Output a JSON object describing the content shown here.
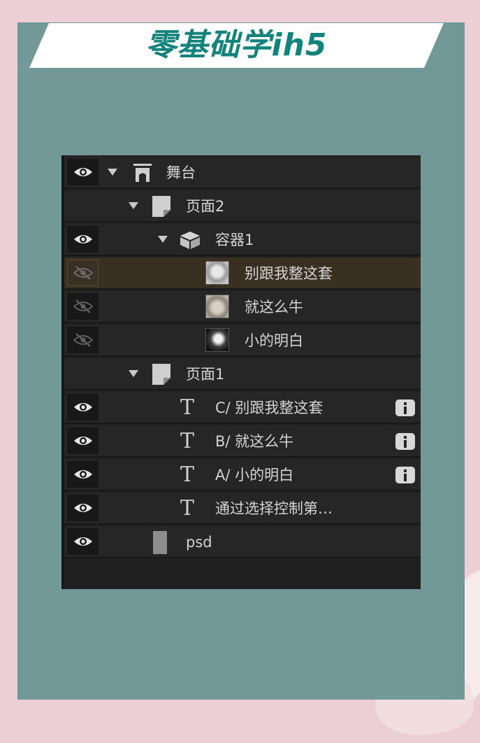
{
  "banner": {
    "title": "零基础学ih5"
  },
  "layers": {
    "stage": {
      "label": "舞台",
      "visible": true,
      "icon": "stage-icon"
    },
    "page2": {
      "label": "页面2",
      "icon": "page-icon"
    },
    "container1": {
      "label": "容器1",
      "visible": true,
      "icon": "box-icon"
    },
    "img_a": {
      "label": "别跟我整这套",
      "visible": false,
      "selected": true,
      "icon": "image-thumbnail"
    },
    "img_b": {
      "label": "就这么牛",
      "visible": false,
      "icon": "image-thumbnail"
    },
    "img_c": {
      "label": "小的明白",
      "visible": false,
      "icon": "image-thumbnail"
    },
    "page1": {
      "label": "页面1",
      "icon": "page-icon"
    },
    "text_c": {
      "label": "C/ 别跟我整这套",
      "visible": true,
      "icon": "text-icon",
      "badge": "info-icon"
    },
    "text_b": {
      "label": "B/ 就这么牛",
      "visible": true,
      "icon": "text-icon",
      "badge": "info-icon"
    },
    "text_a": {
      "label": "A/ 小的明白",
      "visible": true,
      "icon": "text-icon",
      "badge": "info-icon"
    },
    "text_d": {
      "label": "通过选择控制第…",
      "visible": true,
      "icon": "text-icon"
    },
    "psd": {
      "label": "psd",
      "visible": true,
      "icon": "psd-icon"
    }
  },
  "colors": {
    "page_bg": "#eccfd4",
    "card_bg": "#739898",
    "title_color": "#13837c",
    "panel_bg": "#202020",
    "row_bg": "#262626",
    "selected_row_bg": "#3a3022"
  }
}
